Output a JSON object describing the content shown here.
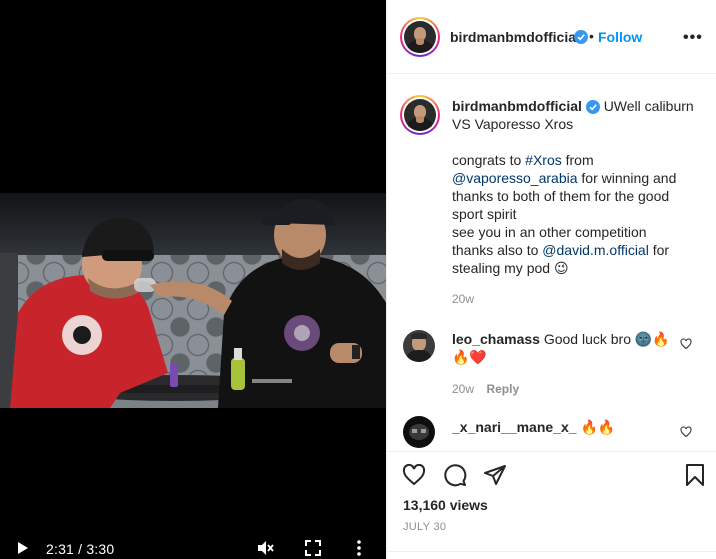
{
  "video": {
    "time_display": "2:31 / 3:30",
    "icons": {
      "play": "play-icon",
      "mute": "muted-speaker-icon",
      "fullscreen": "fullscreen-icon",
      "menu": "more-vertical-icon"
    }
  },
  "post_header": {
    "username": "birdmanbmdofficial",
    "separator": "•",
    "follow_label": "Follow",
    "more_label": "•••"
  },
  "caption": {
    "username": "birdmanbmdofficial",
    "title_text": "UWell caliburn VS Vaporesso Xros",
    "lines": [
      {
        "pre": "congrats to ",
        "link": "#Xros",
        "post": " from"
      },
      {
        "pre": "",
        "link": "@vaporesso_arabia",
        "post": " for winning and"
      },
      {
        "pre": "thanks to both of them for the good",
        "link": "",
        "post": ""
      },
      {
        "pre": "sport spirit",
        "link": "",
        "post": ""
      },
      {
        "pre": "see you in an other competition",
        "link": "",
        "post": ""
      },
      {
        "pre": "thanks also to ",
        "link": "@david.m.official",
        "post": " for"
      },
      {
        "pre": "stealing my pod ",
        "link": "",
        "post": "😉"
      }
    ],
    "age": "20w"
  },
  "comments": [
    {
      "username": "leo_chamass",
      "text": "Good luck bro 🌚🔥",
      "text2": "🔥❤️",
      "age": "20w",
      "reply_label": "Reply"
    },
    {
      "username": "_x_nari__mane_x_",
      "text": "🔥🔥"
    }
  ],
  "actions": {
    "views": "13,160 views",
    "date": "JULY 30"
  },
  "colors": {
    "link_blue": "#0095f6",
    "verified_blue": "#3897f0",
    "text": "#262626",
    "muted": "#8e8e8e"
  }
}
